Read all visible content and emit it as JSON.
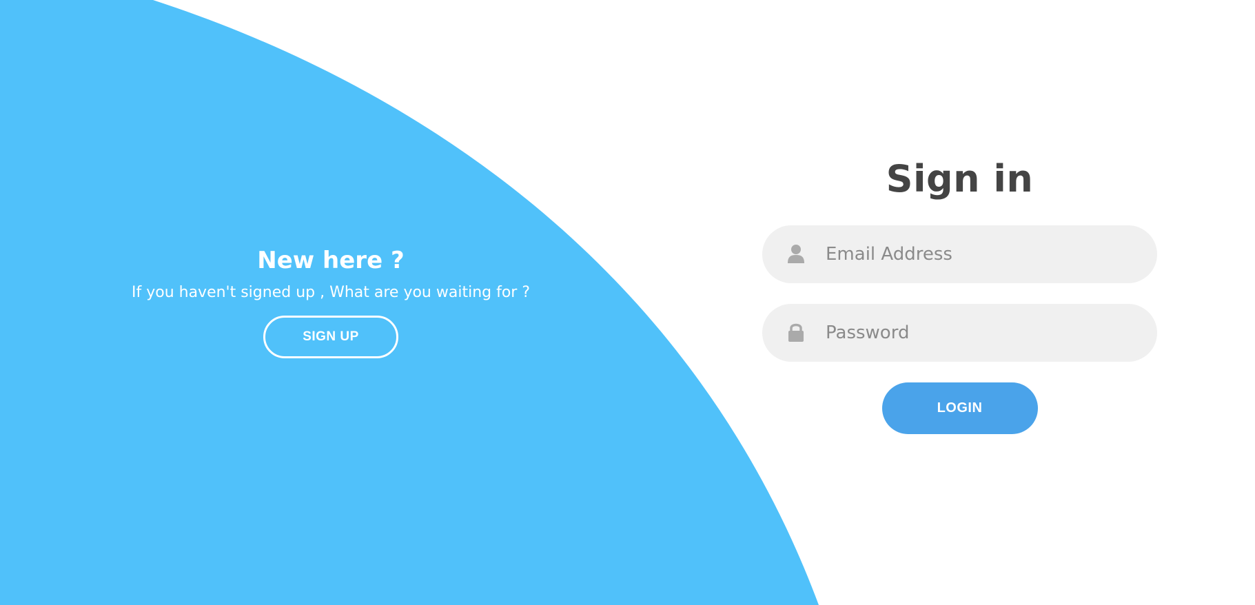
{
  "colors": {
    "panel_blue": "#50c1fa",
    "button_blue": "#4aa3ea",
    "input_bg": "#f0f0f0",
    "title_text": "#444444",
    "placeholder_text": "#8a8a8a"
  },
  "promo": {
    "title": "New here ?",
    "text": "If you haven't signed up , What are you waiting for ?",
    "signup_label": "SIGN UP"
  },
  "signin": {
    "title": "Sign in",
    "email": {
      "placeholder": "Email Address",
      "value": "",
      "icon": "user-icon"
    },
    "password": {
      "placeholder": "Password",
      "value": "",
      "icon": "lock-icon"
    },
    "login_label": "LOGIN"
  }
}
